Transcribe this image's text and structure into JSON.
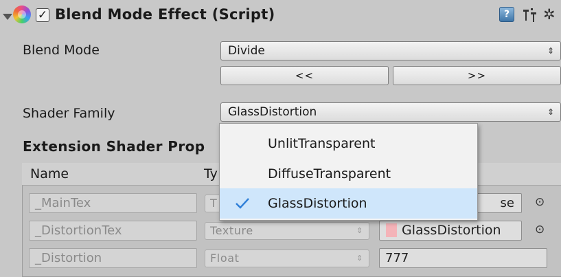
{
  "component": {
    "title": "Blend Mode Effect (Script)",
    "enabled": true,
    "icons": [
      "foldout-arrow-icon",
      "component-color-icon",
      "help-icon",
      "preset-icon",
      "gear-icon"
    ],
    "help_glyph": "?",
    "enable_glyph": "✓",
    "gear_glyph": "✲"
  },
  "blend_mode": {
    "label": "Blend Mode",
    "value": "Divide",
    "prev_label": "<<",
    "next_label": ">>"
  },
  "shader_family": {
    "label": "Shader Family",
    "value": "GlassDistortion"
  },
  "extension": {
    "title": "Extension Shader Prop",
    "headers": {
      "name": "Name",
      "type": "Ty"
    },
    "rows": [
      {
        "name": "_MainTex",
        "type": "T",
        "value": "se"
      },
      {
        "name": "_DistortionTex",
        "type": "Texture",
        "value": "GlassDistortion"
      },
      {
        "name": "_Distortion",
        "type": "Float",
        "value": "777"
      }
    ],
    "picker_glyph": "⊙",
    "popup_arrow": "⇕"
  },
  "dropdown": {
    "options": [
      "UnlitTransparent",
      "DiffuseTransparent",
      "GlassDistortion"
    ],
    "selected": "GlassDistortion"
  },
  "colors": {
    "background": "#c8c8c8",
    "menu_highlight": "#cfe6fb",
    "check_blue": "#2f7fd8",
    "swatch": "#f4b3b8"
  }
}
